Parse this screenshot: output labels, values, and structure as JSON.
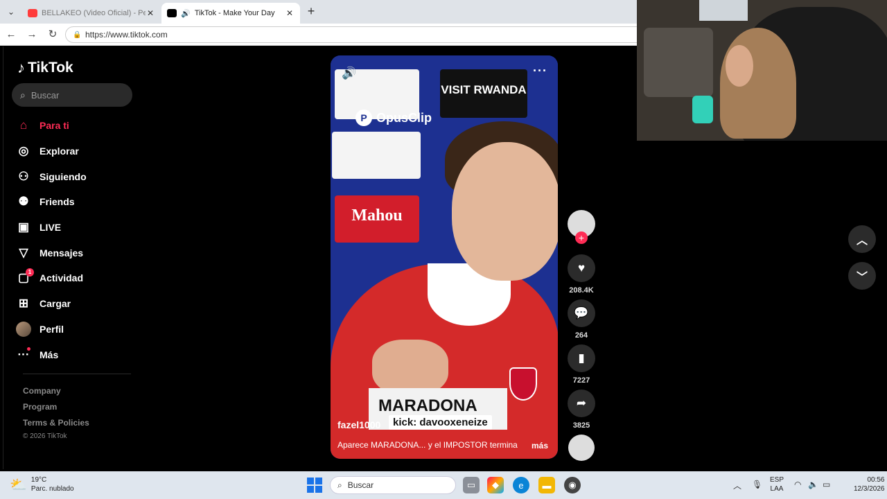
{
  "browser": {
    "tab_list_icon": "chevron-down-icon",
    "tabs": [
      {
        "title": "BELLAKEO (Video Oficial) - Peso P",
        "favicon_color": "#ff3b3b"
      },
      {
        "title": "TikTok - Make Your Day",
        "favicon_color": "#000000"
      }
    ],
    "url": "https://www.tiktok.com"
  },
  "sidebar": {
    "logo": "TikTok",
    "search_placeholder": "Buscar",
    "items": [
      {
        "label": "Para ti",
        "icon": "home-icon",
        "glyph": "⌂"
      },
      {
        "label": "Explorar",
        "icon": "compass-icon",
        "glyph": "◎"
      },
      {
        "label": "Siguiendo",
        "icon": "user-plus-icon",
        "glyph": "⚇"
      },
      {
        "label": "Friends",
        "icon": "friends-icon",
        "glyph": "⚉"
      },
      {
        "label": "LIVE",
        "icon": "live-tv-icon",
        "glyph": "▣"
      },
      {
        "label": "Mensajes",
        "icon": "send-icon",
        "glyph": "▽"
      },
      {
        "label": "Actividad",
        "icon": "activity-icon",
        "glyph": "▢",
        "badge": "1"
      },
      {
        "label": "Cargar",
        "icon": "upload-icon",
        "glyph": "⊞"
      },
      {
        "label": "Perfil",
        "icon": "avatar"
      },
      {
        "label": "Más",
        "icon": "more-icon",
        "glyph": "···"
      }
    ],
    "footer": {
      "links": [
        "Company",
        "Program",
        "Terms & Policies"
      ],
      "copyright": "© 2026 TikTok"
    }
  },
  "video": {
    "watermark": "OpusClip",
    "sponsor_top": "VISIT RWANDA",
    "sponsor_mid": "Mahou",
    "nameplate": "MARADONA",
    "username": "fazel1000",
    "overlay_tag": "kick: davooxeneize",
    "caption": "Aparece MARADONA... y el IMPOSTOR termina",
    "more_label": "más"
  },
  "actions": {
    "likes": "208.4K",
    "comments": "264",
    "saves": "7227",
    "shares": "3825"
  },
  "taskbar": {
    "weather_temp": "19°C",
    "weather_desc": "Parc. nublado",
    "search_label": "Buscar",
    "lang_top": "ESP",
    "lang_bottom": "LAA",
    "time": "00:56",
    "date": "12/3/2026"
  }
}
